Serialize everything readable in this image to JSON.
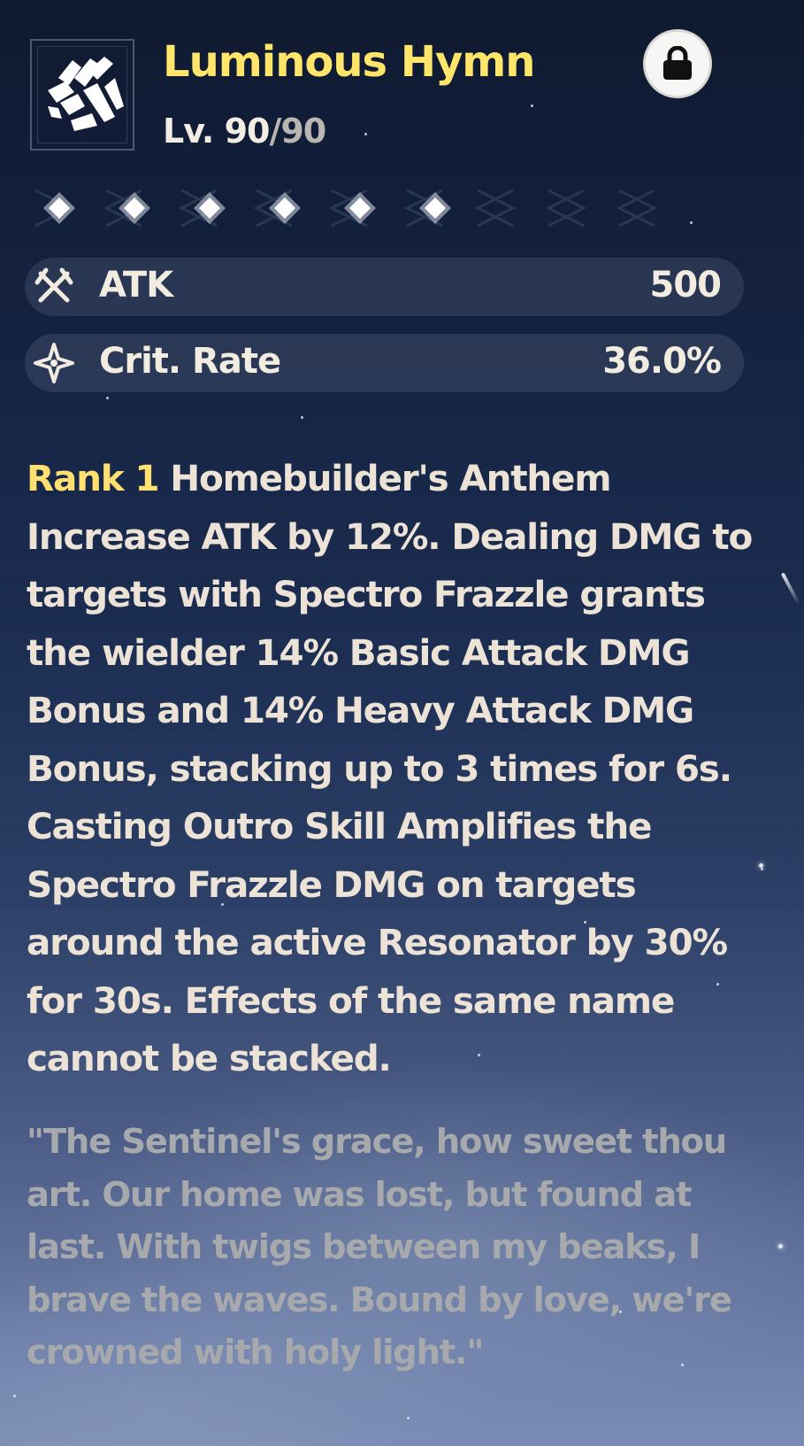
{
  "weapon": {
    "icon": "luminous-hymn-weapon-icon",
    "name": "Luminous Hymn",
    "level_label": "Lv. ",
    "level_current": "90",
    "level_max": "/90",
    "locked": true,
    "lock_icon": "lock-icon",
    "rank_gems": 6
  },
  "stats": [
    {
      "icon": "crossed-swords-icon",
      "label": "ATK",
      "value": "500"
    },
    {
      "icon": "four-point-star-icon",
      "label": "Crit. Rate",
      "value": "36.0%"
    }
  ],
  "passive": {
    "rank_label": "Rank 1",
    "name": " Homebuilder's Anthem",
    "description": "Increase ATK by 12%. Dealing DMG to targets with Spectro Frazzle grants the wielder 14% Basic Attack DMG Bonus and 14% Heavy Attack DMG Bonus, stacking up to 3 times for 6s. Casting Outro Skill Amplifies the Spectro Frazzle DMG on targets around the active Resonator by 30% for 30s. Effects of the same name cannot be stacked."
  },
  "lore": "\"The Sentinel's grace, how sweet thou art. Our home was lost, but found at last. With twigs between my beaks, I brave the waves. Bound by love, we're crowned with holy light.\"",
  "colors": {
    "title": "#ffe66b",
    "rank_label": "#ffe070",
    "body_text": "#ece3d6",
    "lore_text": "#a7a9ad"
  }
}
